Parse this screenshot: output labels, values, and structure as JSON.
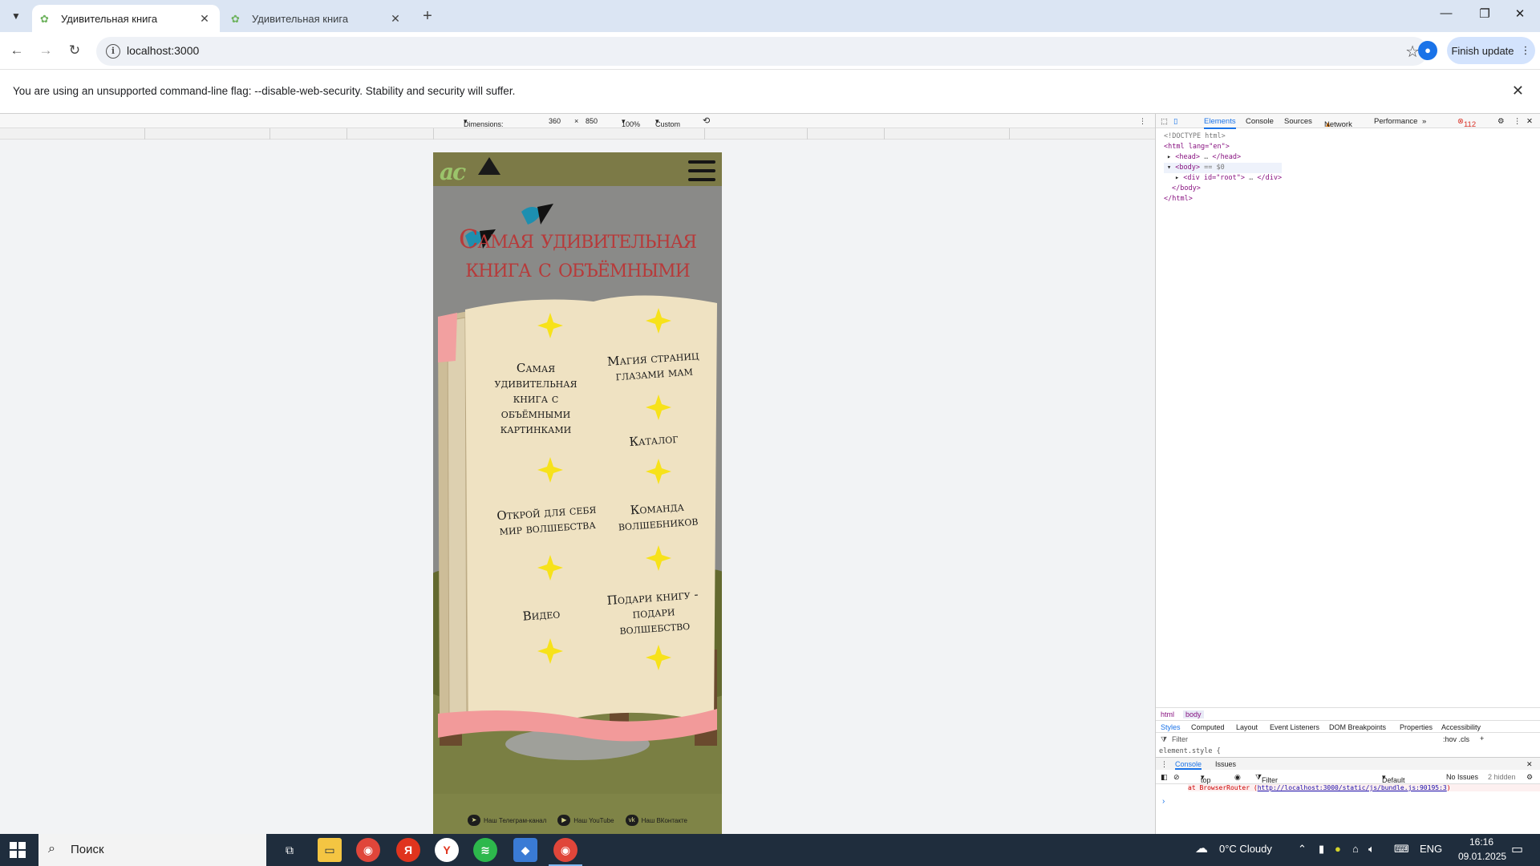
{
  "browser": {
    "tabs": [
      {
        "title": "Удивительная книга",
        "active": true
      },
      {
        "title": "Удивительная книга",
        "active": false
      }
    ],
    "url": "localhost:3000",
    "finish_update": "Finish update",
    "infobar": "You are using an unsupported command-line flag: --disable-web-security. Stability and security will suffer."
  },
  "device_toolbar": {
    "dimensions_label": "Dimensions: Momil",
    "width": "360",
    "times": "×",
    "height": "850",
    "zoom": "100%",
    "throttle": "Custom"
  },
  "page": {
    "logo": "ac",
    "title": "Самая удивительная книга с объёмными",
    "menu": [
      "Самая удивительная книга с объёмными картинками",
      "Магия страниц глазами мам",
      "Каталог",
      "Открой для себя мир волшебства",
      "Команда волшебников",
      "Видео",
      "Подари книгу - подари волшебство"
    ],
    "footer": [
      {
        "label": "Наш Телеграм-канал",
        "icon": "telegram-icon"
      },
      {
        "label": "Наш YouTube",
        "icon": "youtube-icon"
      },
      {
        "label": "Наш ВКонтакте",
        "icon": "vk-icon"
      }
    ],
    "colors": {
      "accent_title": "#b73a3a",
      "star": "#f7e21a",
      "parchment": "#efe2c2",
      "header": "#7c7a47"
    }
  },
  "devtools": {
    "tabs": [
      "Elements",
      "Console",
      "Sources",
      "Network",
      "Performance"
    ],
    "error_count": "112",
    "dom": {
      "doctype": "<!DOCTYPE html>",
      "html_open": "<html lang=\"en\">",
      "head": "<head>",
      "head_close": "</head>",
      "body": "<body>",
      "body_marker": "== $0",
      "div": "<div id=\"root\">",
      "div_close": "</div>",
      "body_close": "</body>",
      "html_close": "</html>"
    },
    "breadcrumbs": [
      "html",
      "body"
    ],
    "style_tabs": [
      "Styles",
      "Computed",
      "Layout",
      "Event Listeners",
      "DOM Breakpoints",
      "Properties",
      "Accessibility"
    ],
    "filter": "Filter",
    "filter_tools": ":hov .cls",
    "element_style": "element.style {",
    "drawer_tabs": [
      "Console",
      "Issues"
    ],
    "console_context": "top",
    "console_filter": "Filter",
    "levels": "Default levels",
    "no_issues": "No Issues",
    "hidden": "2 hidden",
    "console_line_prefix": "at BrowserRouter (",
    "console_line_link": "http://localhost:3000/static/js/bundle.js:90195:3",
    "console_line_suffix": ")"
  },
  "taskbar": {
    "search": "Поиск",
    "weather": "0°C Cloudy",
    "lang": "ENG",
    "time": "16:16",
    "date": "09.01.2025"
  }
}
